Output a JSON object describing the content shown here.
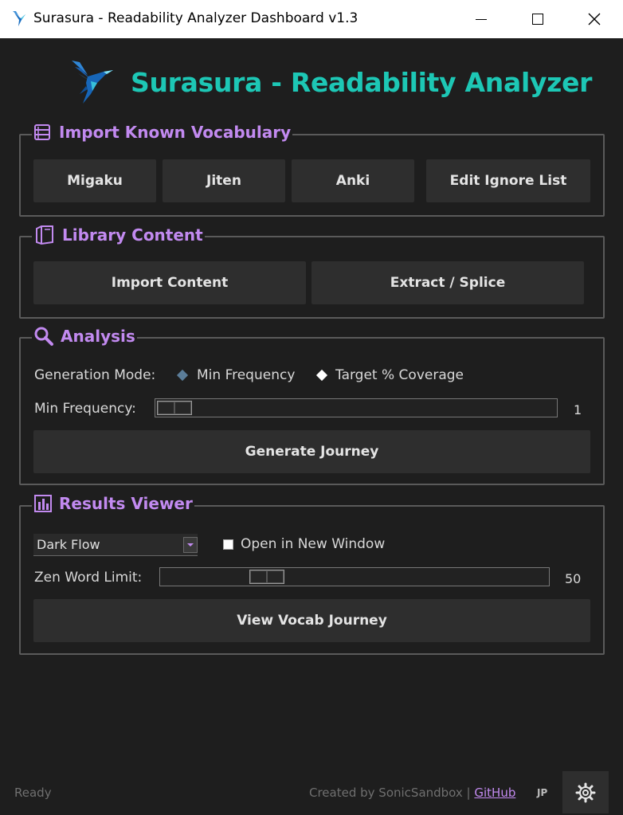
{
  "window": {
    "title": "Surasura - Readability Analyzer Dashboard v1.3"
  },
  "header": {
    "app_title": "Surasura - Readability Analyzer"
  },
  "vocab": {
    "legend": "Import Known Vocabulary",
    "buttons": [
      "Migaku",
      "Jiten",
      "Anki",
      "Edit Ignore List"
    ]
  },
  "library": {
    "legend": "Library Content",
    "import_label": "Import Content",
    "extract_label": "Extract / Splice"
  },
  "analysis": {
    "legend": "Analysis",
    "mode_label": "Generation Mode:",
    "mode_options": [
      "Min Frequency",
      "Target % Coverage"
    ],
    "selected_mode": "Min Frequency",
    "freq_label": "Min Frequency:",
    "freq_value": "1",
    "generate_label": "Generate Journey"
  },
  "results": {
    "legend": "Results Viewer",
    "theme_value": "Dark Flow",
    "new_window_label": "Open in New Window",
    "new_window_checked": false,
    "zen_label": "Zen Word Limit:",
    "zen_value": "50",
    "view_label": "View Vocab Journey"
  },
  "footer": {
    "status": "Ready",
    "credit_prefix": "Created by SonicSandbox | ",
    "github_label": "GitHub",
    "language": "JP"
  },
  "colors": {
    "accent_title": "#1dc7b5",
    "accent_purple": "#c28af0",
    "background": "#1e1e1e",
    "button": "#2e2e2e"
  }
}
